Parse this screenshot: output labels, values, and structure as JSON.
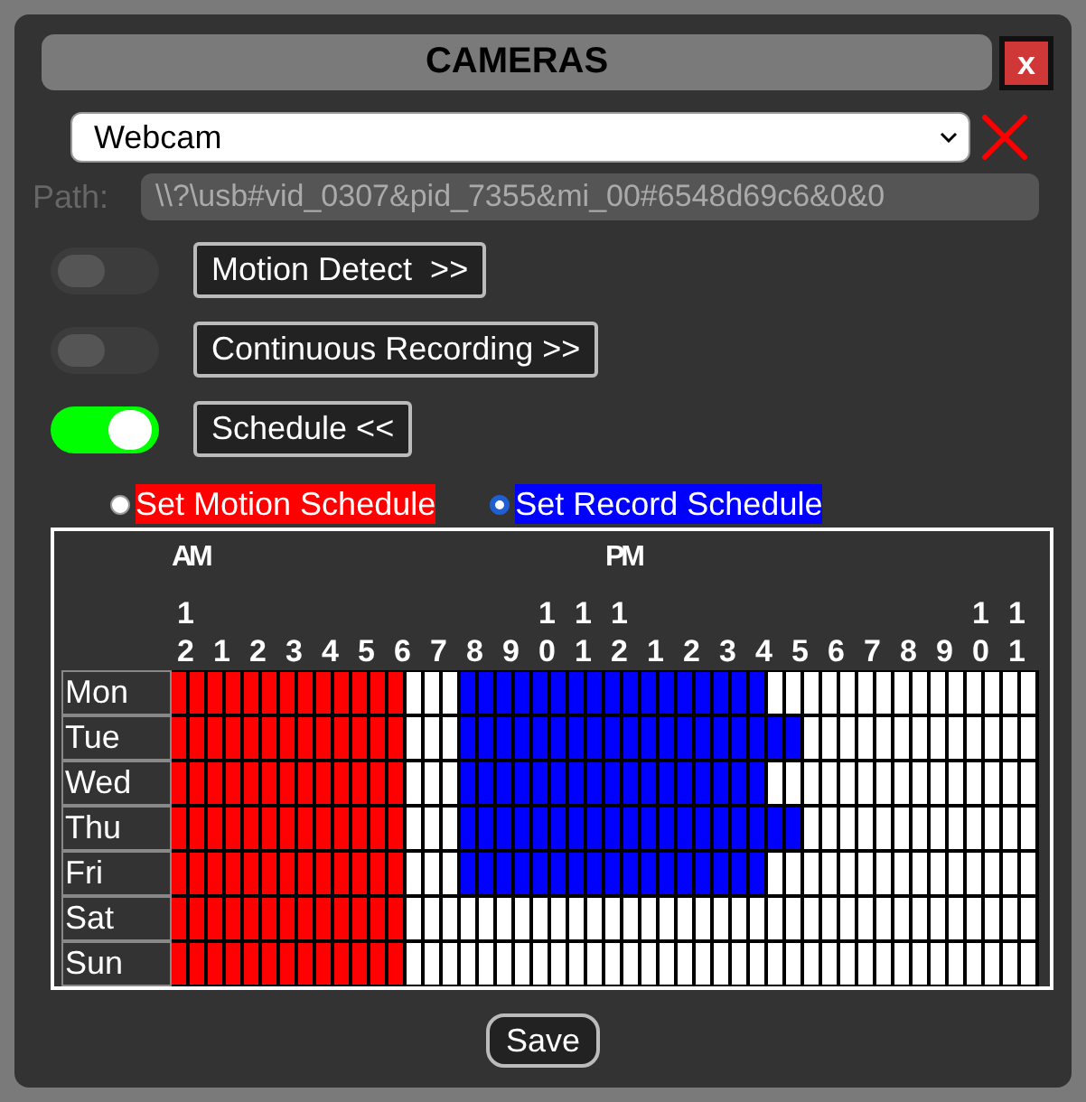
{
  "window": {
    "title": "CAMERAS",
    "close_label": "x"
  },
  "camera_select": {
    "value": "Webcam"
  },
  "path": {
    "label": "Path:",
    "value": "\\\\?\\usb#vid_0307&pid_7355&mi_00#6548d69c6&0&0"
  },
  "features": [
    {
      "label": "Motion Detect  >>",
      "on": false
    },
    {
      "label": "Continuous Recording >>",
      "on": false
    },
    {
      "label": "Schedule <<",
      "on": true
    }
  ],
  "schedule_modes": [
    {
      "label": "Set Motion Schedule",
      "selected": false,
      "color": "#ff0000"
    },
    {
      "label": "Set Record Schedule",
      "selected": true,
      "color": "#0000ff"
    }
  ],
  "schedule": {
    "periods": [
      "AM",
      "PM"
    ],
    "hours": [
      "12",
      "1",
      "2",
      "3",
      "4",
      "5",
      "6",
      "7",
      "8",
      "9",
      "10",
      "11",
      "12",
      "1",
      "2",
      "3",
      "4",
      "5",
      "6",
      "7",
      "8",
      "9",
      "10",
      "11"
    ],
    "days": [
      {
        "label": "Mon",
        "slots": [
          {
            "kind": "motion"
          },
          {
            "kind": "motion"
          },
          {
            "kind": "motion"
          },
          {
            "kind": "motion"
          },
          {
            "kind": "motion"
          },
          {
            "kind": "motion"
          },
          {
            "kind": "motion"
          },
          {
            "kind": "motion"
          },
          {
            "kind": "motion"
          },
          {
            "kind": "motion"
          },
          {
            "kind": "motion"
          },
          {
            "kind": "motion"
          },
          {
            "kind": "motion"
          },
          {
            "kind": "off"
          },
          {
            "kind": "off"
          },
          {
            "kind": "off"
          },
          {
            "kind": "record"
          },
          {
            "kind": "record"
          },
          {
            "kind": "record"
          },
          {
            "kind": "record"
          },
          {
            "kind": "record"
          },
          {
            "kind": "record"
          },
          {
            "kind": "record"
          },
          {
            "kind": "record"
          },
          {
            "kind": "record"
          },
          {
            "kind": "record"
          },
          {
            "kind": "record"
          },
          {
            "kind": "record"
          },
          {
            "kind": "record"
          },
          {
            "kind": "record"
          },
          {
            "kind": "record"
          },
          {
            "kind": "record"
          },
          {
            "kind": "record"
          },
          {
            "kind": "off"
          },
          {
            "kind": "off"
          },
          {
            "kind": "off"
          },
          {
            "kind": "off"
          },
          {
            "kind": "off"
          },
          {
            "kind": "off"
          },
          {
            "kind": "off"
          },
          {
            "kind": "off"
          },
          {
            "kind": "off"
          },
          {
            "kind": "off"
          },
          {
            "kind": "off"
          },
          {
            "kind": "off"
          },
          {
            "kind": "off"
          },
          {
            "kind": "off"
          },
          {
            "kind": "off"
          }
        ]
      },
      {
        "label": "Tue",
        "slots": [
          {
            "kind": "motion"
          },
          {
            "kind": "motion"
          },
          {
            "kind": "motion"
          },
          {
            "kind": "motion"
          },
          {
            "kind": "motion"
          },
          {
            "kind": "motion"
          },
          {
            "kind": "motion"
          },
          {
            "kind": "motion"
          },
          {
            "kind": "motion"
          },
          {
            "kind": "motion"
          },
          {
            "kind": "motion"
          },
          {
            "kind": "motion"
          },
          {
            "kind": "motion"
          },
          {
            "kind": "off"
          },
          {
            "kind": "off"
          },
          {
            "kind": "off"
          },
          {
            "kind": "record"
          },
          {
            "kind": "record"
          },
          {
            "kind": "record"
          },
          {
            "kind": "record"
          },
          {
            "kind": "record"
          },
          {
            "kind": "record"
          },
          {
            "kind": "record"
          },
          {
            "kind": "record"
          },
          {
            "kind": "record"
          },
          {
            "kind": "record"
          },
          {
            "kind": "record"
          },
          {
            "kind": "record"
          },
          {
            "kind": "record"
          },
          {
            "kind": "record"
          },
          {
            "kind": "record"
          },
          {
            "kind": "record"
          },
          {
            "kind": "record"
          },
          {
            "kind": "record"
          },
          {
            "kind": "record"
          },
          {
            "kind": "off"
          },
          {
            "kind": "off"
          },
          {
            "kind": "off"
          },
          {
            "kind": "off"
          },
          {
            "kind": "off"
          },
          {
            "kind": "off"
          },
          {
            "kind": "off"
          },
          {
            "kind": "off"
          },
          {
            "kind": "off"
          },
          {
            "kind": "off"
          },
          {
            "kind": "off"
          },
          {
            "kind": "off"
          },
          {
            "kind": "off"
          }
        ]
      },
      {
        "label": "Wed",
        "slots": [
          {
            "kind": "motion"
          },
          {
            "kind": "motion"
          },
          {
            "kind": "motion"
          },
          {
            "kind": "motion"
          },
          {
            "kind": "motion"
          },
          {
            "kind": "motion"
          },
          {
            "kind": "motion"
          },
          {
            "kind": "motion"
          },
          {
            "kind": "motion"
          },
          {
            "kind": "motion"
          },
          {
            "kind": "motion"
          },
          {
            "kind": "motion"
          },
          {
            "kind": "motion"
          },
          {
            "kind": "off"
          },
          {
            "kind": "off"
          },
          {
            "kind": "off"
          },
          {
            "kind": "record"
          },
          {
            "kind": "record"
          },
          {
            "kind": "record"
          },
          {
            "kind": "record"
          },
          {
            "kind": "record"
          },
          {
            "kind": "record"
          },
          {
            "kind": "record"
          },
          {
            "kind": "record"
          },
          {
            "kind": "record"
          },
          {
            "kind": "record"
          },
          {
            "kind": "record"
          },
          {
            "kind": "record"
          },
          {
            "kind": "record"
          },
          {
            "kind": "record"
          },
          {
            "kind": "record"
          },
          {
            "kind": "record"
          },
          {
            "kind": "record"
          },
          {
            "kind": "off"
          },
          {
            "kind": "off"
          },
          {
            "kind": "off"
          },
          {
            "kind": "off"
          },
          {
            "kind": "off"
          },
          {
            "kind": "off"
          },
          {
            "kind": "off"
          },
          {
            "kind": "off"
          },
          {
            "kind": "off"
          },
          {
            "kind": "off"
          },
          {
            "kind": "off"
          },
          {
            "kind": "off"
          },
          {
            "kind": "off"
          },
          {
            "kind": "off"
          },
          {
            "kind": "off"
          }
        ]
      },
      {
        "label": "Thu",
        "slots": [
          {
            "kind": "motion"
          },
          {
            "kind": "motion"
          },
          {
            "kind": "motion"
          },
          {
            "kind": "motion"
          },
          {
            "kind": "motion"
          },
          {
            "kind": "motion"
          },
          {
            "kind": "motion"
          },
          {
            "kind": "motion"
          },
          {
            "kind": "motion"
          },
          {
            "kind": "motion"
          },
          {
            "kind": "motion"
          },
          {
            "kind": "motion"
          },
          {
            "kind": "motion"
          },
          {
            "kind": "off"
          },
          {
            "kind": "off"
          },
          {
            "kind": "off"
          },
          {
            "kind": "record"
          },
          {
            "kind": "record"
          },
          {
            "kind": "record"
          },
          {
            "kind": "record"
          },
          {
            "kind": "record"
          },
          {
            "kind": "record"
          },
          {
            "kind": "record"
          },
          {
            "kind": "record"
          },
          {
            "kind": "record"
          },
          {
            "kind": "record"
          },
          {
            "kind": "record"
          },
          {
            "kind": "record"
          },
          {
            "kind": "record"
          },
          {
            "kind": "record"
          },
          {
            "kind": "record"
          },
          {
            "kind": "record"
          },
          {
            "kind": "record"
          },
          {
            "kind": "record"
          },
          {
            "kind": "record"
          },
          {
            "kind": "off"
          },
          {
            "kind": "off"
          },
          {
            "kind": "off"
          },
          {
            "kind": "off"
          },
          {
            "kind": "off"
          },
          {
            "kind": "off"
          },
          {
            "kind": "off"
          },
          {
            "kind": "off"
          },
          {
            "kind": "off"
          },
          {
            "kind": "off"
          },
          {
            "kind": "off"
          },
          {
            "kind": "off"
          },
          {
            "kind": "off"
          }
        ]
      },
      {
        "label": "Fri",
        "slots": [
          {
            "kind": "motion"
          },
          {
            "kind": "motion"
          },
          {
            "kind": "motion"
          },
          {
            "kind": "motion"
          },
          {
            "kind": "motion"
          },
          {
            "kind": "motion"
          },
          {
            "kind": "motion"
          },
          {
            "kind": "motion"
          },
          {
            "kind": "motion"
          },
          {
            "kind": "motion"
          },
          {
            "kind": "motion"
          },
          {
            "kind": "motion"
          },
          {
            "kind": "motion"
          },
          {
            "kind": "off"
          },
          {
            "kind": "off"
          },
          {
            "kind": "off"
          },
          {
            "kind": "record"
          },
          {
            "kind": "record"
          },
          {
            "kind": "record"
          },
          {
            "kind": "record"
          },
          {
            "kind": "record"
          },
          {
            "kind": "record"
          },
          {
            "kind": "record"
          },
          {
            "kind": "record"
          },
          {
            "kind": "record"
          },
          {
            "kind": "record"
          },
          {
            "kind": "record"
          },
          {
            "kind": "record"
          },
          {
            "kind": "record"
          },
          {
            "kind": "record"
          },
          {
            "kind": "record"
          },
          {
            "kind": "record"
          },
          {
            "kind": "record"
          },
          {
            "kind": "off"
          },
          {
            "kind": "off"
          },
          {
            "kind": "off"
          },
          {
            "kind": "off"
          },
          {
            "kind": "off"
          },
          {
            "kind": "off"
          },
          {
            "kind": "off"
          },
          {
            "kind": "off"
          },
          {
            "kind": "off"
          },
          {
            "kind": "off"
          },
          {
            "kind": "off"
          },
          {
            "kind": "off"
          },
          {
            "kind": "off"
          },
          {
            "kind": "off"
          },
          {
            "kind": "off"
          }
        ]
      },
      {
        "label": "Sat",
        "slots": [
          {
            "kind": "motion"
          },
          {
            "kind": "motion"
          },
          {
            "kind": "motion"
          },
          {
            "kind": "motion"
          },
          {
            "kind": "motion"
          },
          {
            "kind": "motion"
          },
          {
            "kind": "motion"
          },
          {
            "kind": "motion"
          },
          {
            "kind": "motion"
          },
          {
            "kind": "motion"
          },
          {
            "kind": "motion"
          },
          {
            "kind": "motion"
          },
          {
            "kind": "motion"
          },
          {
            "kind": "off"
          },
          {
            "kind": "off"
          },
          {
            "kind": "off"
          },
          {
            "kind": "off"
          },
          {
            "kind": "off"
          },
          {
            "kind": "off"
          },
          {
            "kind": "off"
          },
          {
            "kind": "off"
          },
          {
            "kind": "off"
          },
          {
            "kind": "off"
          },
          {
            "kind": "off"
          },
          {
            "kind": "off"
          },
          {
            "kind": "off"
          },
          {
            "kind": "off"
          },
          {
            "kind": "off"
          },
          {
            "kind": "off"
          },
          {
            "kind": "off"
          },
          {
            "kind": "off"
          },
          {
            "kind": "off"
          },
          {
            "kind": "off"
          },
          {
            "kind": "off"
          },
          {
            "kind": "off"
          },
          {
            "kind": "off"
          },
          {
            "kind": "off"
          },
          {
            "kind": "off"
          },
          {
            "kind": "off"
          },
          {
            "kind": "off"
          },
          {
            "kind": "off"
          },
          {
            "kind": "off"
          },
          {
            "kind": "off"
          },
          {
            "kind": "off"
          },
          {
            "kind": "off"
          },
          {
            "kind": "off"
          },
          {
            "kind": "off"
          },
          {
            "kind": "off"
          }
        ]
      },
      {
        "label": "Sun",
        "slots": [
          {
            "kind": "motion"
          },
          {
            "kind": "motion"
          },
          {
            "kind": "motion"
          },
          {
            "kind": "motion"
          },
          {
            "kind": "motion"
          },
          {
            "kind": "motion"
          },
          {
            "kind": "motion"
          },
          {
            "kind": "motion"
          },
          {
            "kind": "motion"
          },
          {
            "kind": "motion"
          },
          {
            "kind": "motion"
          },
          {
            "kind": "motion"
          },
          {
            "kind": "motion"
          },
          {
            "kind": "off"
          },
          {
            "kind": "off"
          },
          {
            "kind": "off"
          },
          {
            "kind": "off"
          },
          {
            "kind": "off"
          },
          {
            "kind": "off"
          },
          {
            "kind": "off"
          },
          {
            "kind": "off"
          },
          {
            "kind": "off"
          },
          {
            "kind": "off"
          },
          {
            "kind": "off"
          },
          {
            "kind": "off"
          },
          {
            "kind": "off"
          },
          {
            "kind": "off"
          },
          {
            "kind": "off"
          },
          {
            "kind": "off"
          },
          {
            "kind": "off"
          },
          {
            "kind": "off"
          },
          {
            "kind": "off"
          },
          {
            "kind": "off"
          },
          {
            "kind": "off"
          },
          {
            "kind": "off"
          },
          {
            "kind": "off"
          },
          {
            "kind": "off"
          },
          {
            "kind": "off"
          },
          {
            "kind": "off"
          },
          {
            "kind": "off"
          },
          {
            "kind": "off"
          },
          {
            "kind": "off"
          },
          {
            "kind": "off"
          },
          {
            "kind": "off"
          },
          {
            "kind": "off"
          },
          {
            "kind": "off"
          },
          {
            "kind": "off"
          },
          {
            "kind": "off"
          }
        ]
      }
    ]
  },
  "save_button": {
    "label": "Save"
  }
}
